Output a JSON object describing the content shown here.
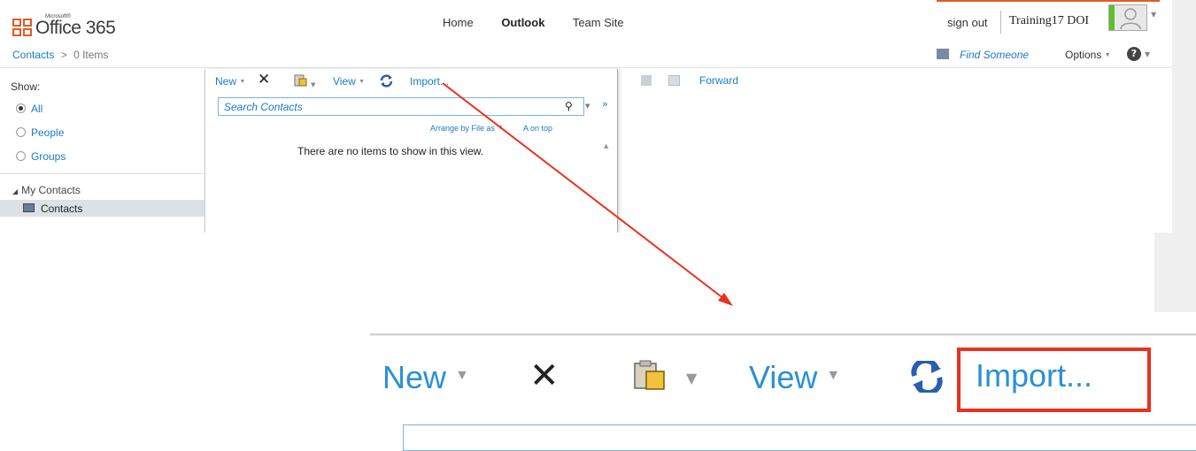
{
  "brand": {
    "small": "Microsoft®",
    "big": "Office 365"
  },
  "topnav": {
    "home": "Home",
    "outlook": "Outlook",
    "team_site": "Team Site"
  },
  "user": {
    "sign_out": "sign out",
    "name": "Training17 DOI"
  },
  "breadcrumb": {
    "folder": "Contacts",
    "sep": ">",
    "count": "0 Items"
  },
  "header_actions": {
    "find_someone": "Find Someone",
    "options": "Options"
  },
  "left_nav": {
    "show_label": "Show:",
    "filters": [
      {
        "label": "All",
        "selected": true
      },
      {
        "label": "People",
        "selected": false
      },
      {
        "label": "Groups",
        "selected": false
      }
    ],
    "tree_header": "My Contacts",
    "tree_item": "Contacts"
  },
  "toolbar": {
    "new": "New",
    "view": "View",
    "import": "Import..."
  },
  "search": {
    "placeholder": "Search Contacts"
  },
  "arrange": {
    "by": "Arrange by File as",
    "order": "A on top"
  },
  "list": {
    "empty": "There are no items to show in this view."
  },
  "reading_pane": {
    "forward": "Forward"
  },
  "zoom": {
    "new": "New",
    "view": "View",
    "import": "Import..."
  },
  "colors": {
    "link": "#1a7bc5",
    "accent": "#e45a23",
    "highlight": "#e8321d",
    "arrow": "#e8321d"
  }
}
